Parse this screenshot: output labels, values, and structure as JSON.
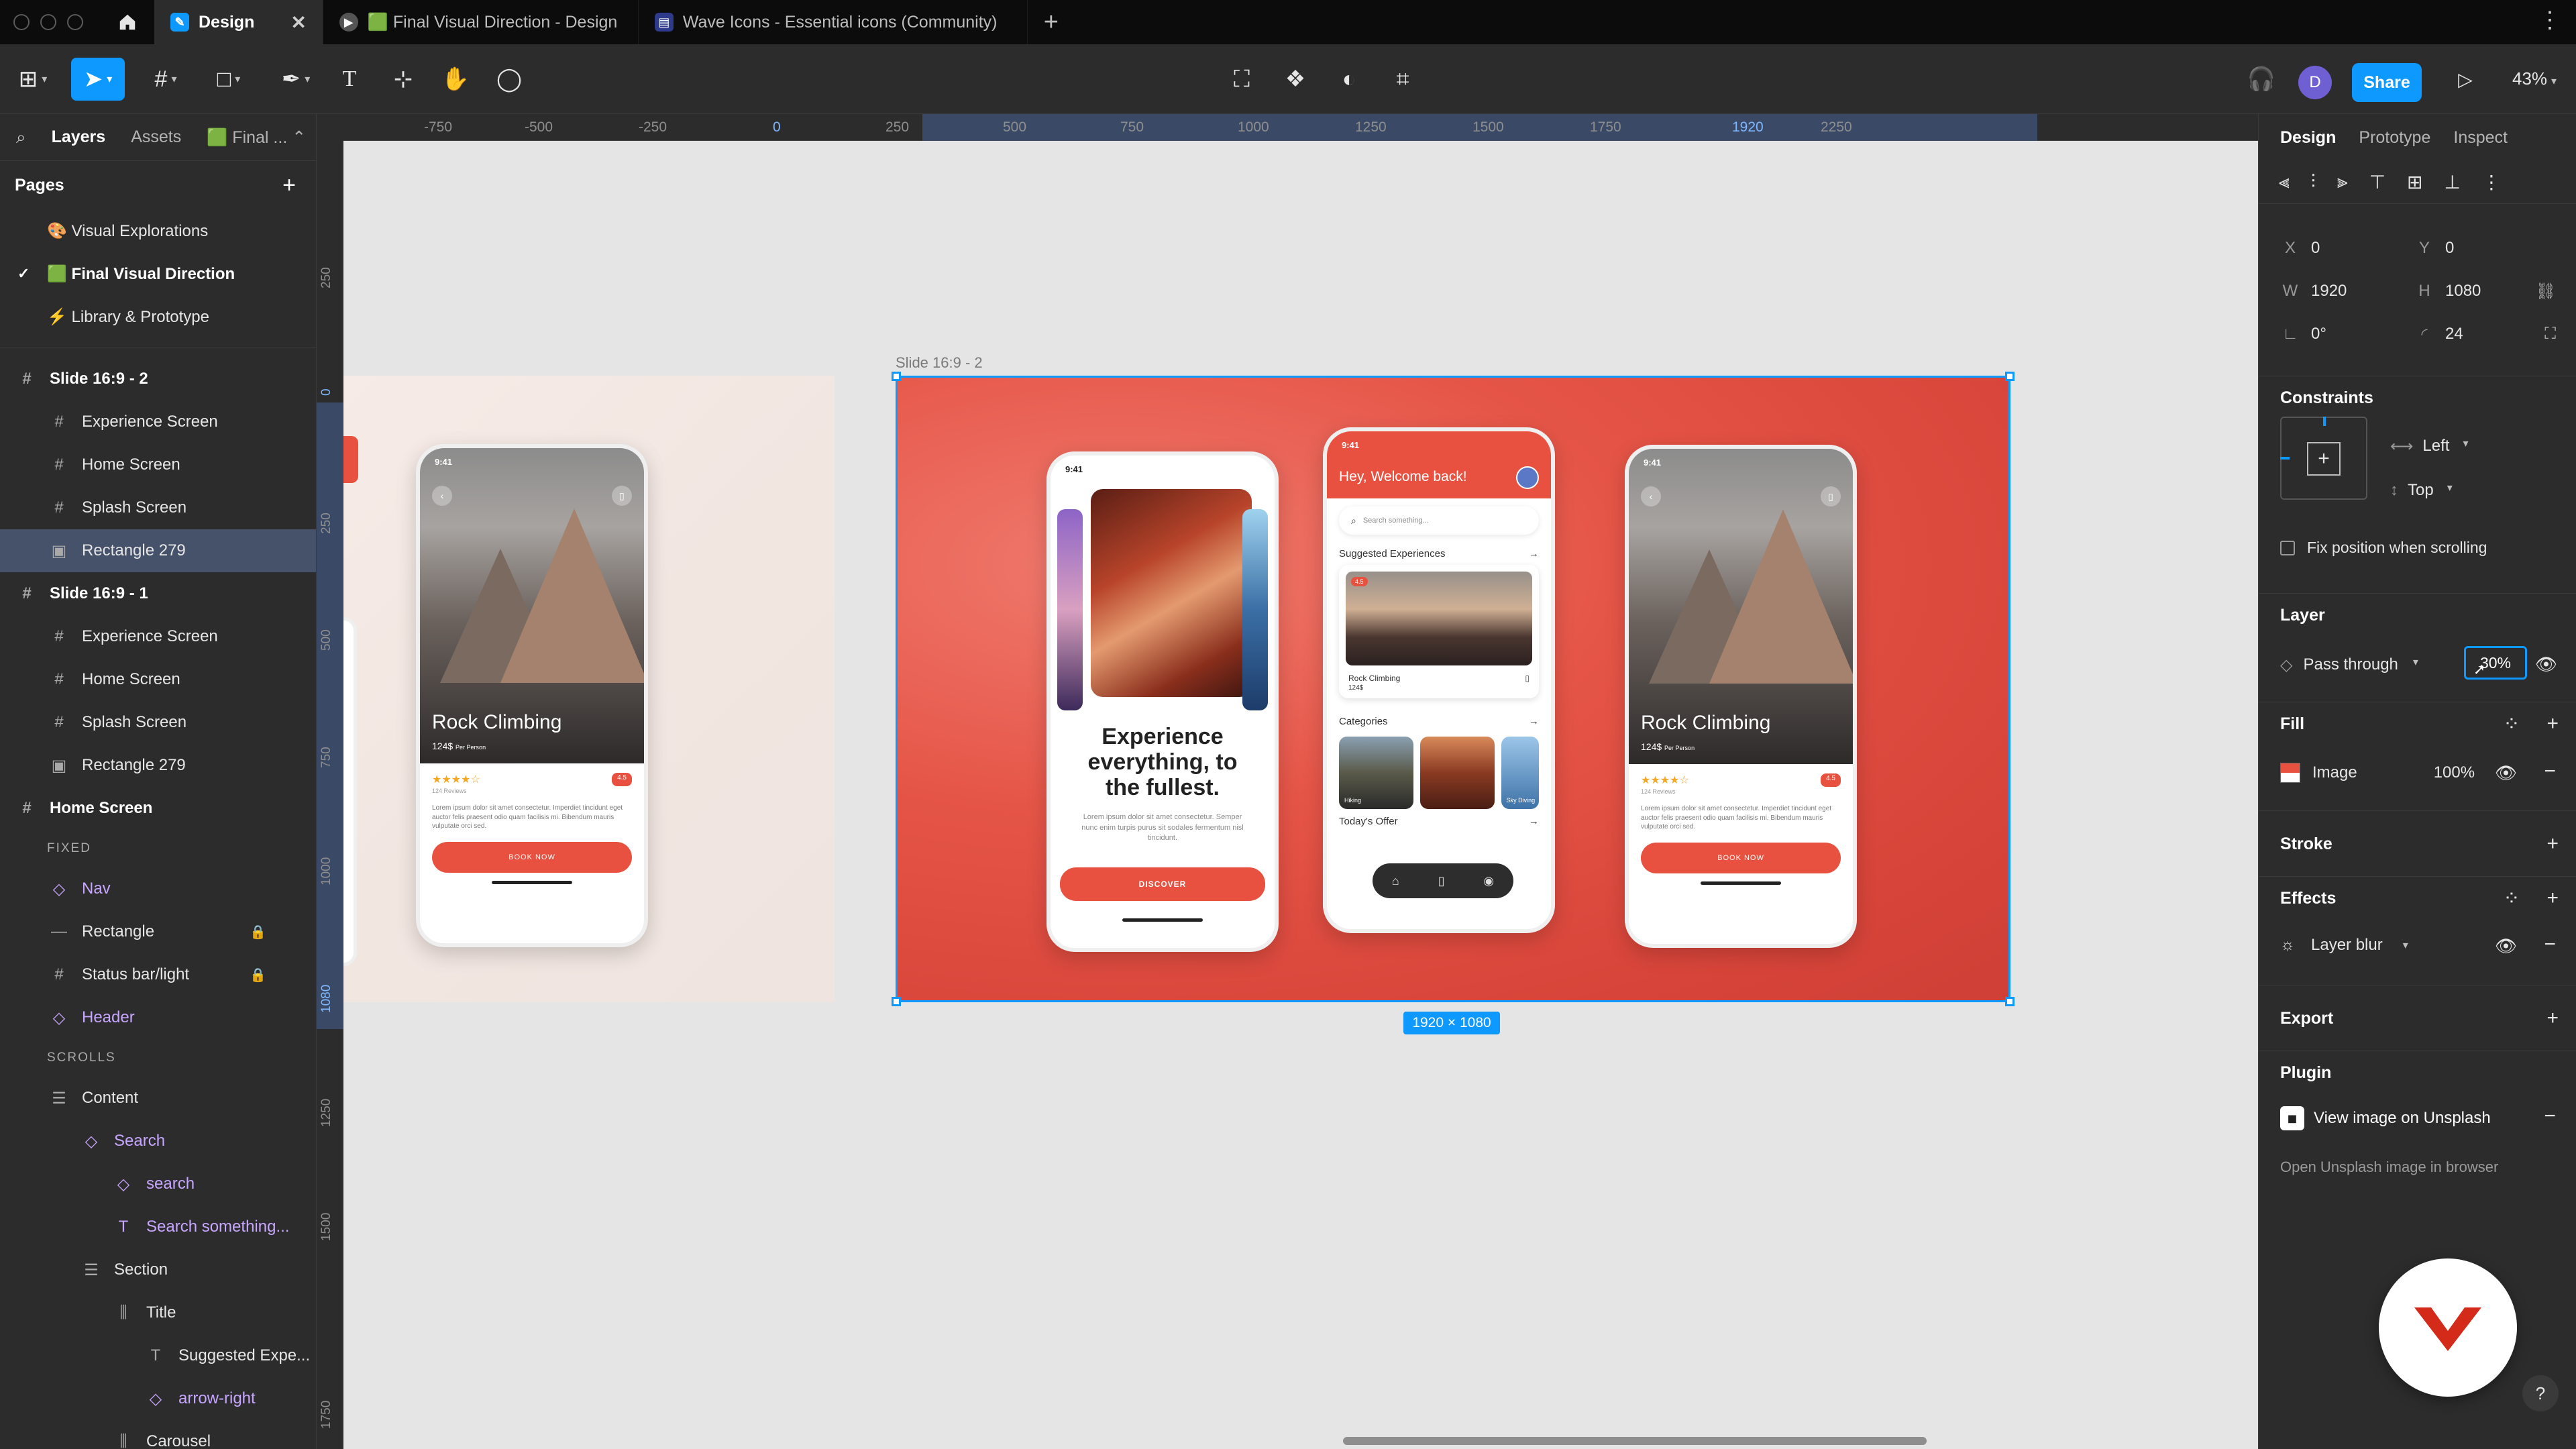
{
  "titlebar": {
    "tabs": [
      {
        "label": "Design",
        "close": "✕"
      },
      {
        "label": "🟩 Final Visual Direction - Design"
      },
      {
        "label": "Wave Icons - Essential icons (Community)"
      }
    ],
    "new_tab": "+",
    "more": "⋮"
  },
  "toolbar": {
    "share": "Share",
    "avatar": "D",
    "zoom": "43%"
  },
  "left": {
    "tabs": [
      "Layers",
      "Assets",
      "🟩 Final ..."
    ],
    "pages_title": "Pages",
    "add": "+",
    "pages": [
      {
        "label": "🎨 Visual Explorations"
      },
      {
        "label": "🟩 Final Visual Direction",
        "current": true
      },
      {
        "label": "⚡ Library & Prototype"
      }
    ],
    "layers": [
      {
        "label": "Slide 16:9 - 2",
        "icon": "#",
        "indent": 0,
        "bold": true
      },
      {
        "label": "Experience Screen",
        "icon": "#",
        "indent": 1
      },
      {
        "label": "Home Screen",
        "icon": "#",
        "indent": 1
      },
      {
        "label": "Splash Screen",
        "icon": "#",
        "indent": 1
      },
      {
        "label": "Rectangle 279",
        "icon": "▣",
        "indent": 1,
        "selected": true
      },
      {
        "label": "Slide 16:9 - 1",
        "icon": "#",
        "indent": 0,
        "bold": true
      },
      {
        "label": "Experience Screen",
        "icon": "#",
        "indent": 1
      },
      {
        "label": "Home Screen",
        "icon": "#",
        "indent": 1
      },
      {
        "label": "Splash Screen",
        "icon": "#",
        "indent": 1
      },
      {
        "label": "Rectangle 279",
        "icon": "▣",
        "indent": 1
      },
      {
        "label": "Home Screen",
        "icon": "#",
        "indent": 0,
        "bold": true
      },
      {
        "section": "FIXED"
      },
      {
        "label": "Nav",
        "icon": "◇",
        "indent": 1,
        "purple": true
      },
      {
        "label": "Rectangle",
        "icon": "—",
        "indent": 1,
        "lock": true
      },
      {
        "label": "Status bar/light",
        "icon": "#",
        "indent": 1,
        "lock": true
      },
      {
        "label": "Header",
        "icon": "◇",
        "indent": 1,
        "purple": true
      },
      {
        "section": "SCROLLS"
      },
      {
        "label": "Content",
        "icon": "☰",
        "indent": 1
      },
      {
        "label": "Search",
        "icon": "◇",
        "indent": 2,
        "purple": true
      },
      {
        "label": "search",
        "icon": "◇",
        "indent": 3,
        "purple": true
      },
      {
        "label": "Search something...",
        "icon": "T",
        "indent": 3,
        "purple": true
      },
      {
        "label": "Section",
        "icon": "☰",
        "indent": 2
      },
      {
        "label": "Title",
        "icon": "⫼",
        "indent": 3
      },
      {
        "label": "Suggested Expe...",
        "icon": "T",
        "indent": 4
      },
      {
        "label": "arrow-right",
        "icon": "◇",
        "indent": 4,
        "purple": true
      },
      {
        "label": "Carousel",
        "icon": "⫼",
        "indent": 3
      }
    ]
  },
  "canvas": {
    "ruler_top": [
      "-750",
      "-500",
      "-250",
      "0",
      "250",
      "500",
      "750",
      "1000",
      "1250",
      "1500",
      "1750",
      "1920",
      "2250"
    ],
    "ruler_left": [
      "250",
      "0",
      "250",
      "500",
      "750",
      "1000",
      "1080",
      "1250",
      "1500",
      "1750"
    ],
    "frame_label": "Slide 16:9 - 2",
    "size_badge": "1920 × 1080",
    "phones": {
      "status_time": "9:41",
      "rock_title": "Rock Climbing",
      "rock_price": "124$",
      "per_person": "Per Person",
      "stars": "★★★★☆",
      "rating": "4.5",
      "reviews": "124 Reviews",
      "lorem_short": "Lorem ipsum dolor sit amet consectetur. Imperdiet tincidunt eget auctor felis praesent odio quam facilisis mi. Bibendum mauris vulputate orci sed.",
      "book_now": "BOOK NOW",
      "exp_heading_1": "Experience",
      "exp_heading_2": "everything, to",
      "exp_heading_3": "the fullest.",
      "exp_body": "Lorem ipsum dolor sit amet consectetur. Semper nunc enim turpis purus sit sodales fermentum nisl tincidunt.",
      "discover": "DISCOVER",
      "welcome": "Hey, Welcome back!",
      "search_placeholder": "Search something...",
      "suggested": "Suggested Experiences",
      "card_rating": "4.5",
      "card_name": "Rock Climbing",
      "card_price": "124$",
      "categories": "Categories",
      "cat_1": "Hiking",
      "cat_3": "Sky Diving",
      "todays_offer": "Today's Offer",
      "arrow": "→"
    }
  },
  "right": {
    "tabs": [
      "Design",
      "Prototype",
      "Inspect"
    ],
    "x": {
      "label": "X",
      "value": "0"
    },
    "y": {
      "label": "Y",
      "value": "0"
    },
    "w": {
      "label": "W",
      "value": "1920"
    },
    "h": {
      "label": "H",
      "value": "1080"
    },
    "rotation": {
      "label": "∟",
      "value": "0°"
    },
    "radius": {
      "label": "◜",
      "value": "24"
    },
    "constraints_title": "Constraints",
    "constraint_h": "Left",
    "constraint_v": "Top",
    "fix_position": "Fix position when scrolling",
    "layer_title": "Layer",
    "blend": "Pass through",
    "opacity": "30%",
    "fill_title": "Fill",
    "fill_type": "Image",
    "fill_opacity": "100%",
    "stroke_title": "Stroke",
    "effects_title": "Effects",
    "effect": "Layer blur",
    "export_title": "Export",
    "plugin_title": "Plugin",
    "plugin_action": "View image on Unsplash",
    "plugin_sub": "Open Unsplash image in browser",
    "help": "?"
  },
  "colors": {
    "accent": "#0d99ff",
    "brand_red": "#e8513f",
    "panel": "#2c2c2c",
    "canvas": "#e5e5e5"
  }
}
